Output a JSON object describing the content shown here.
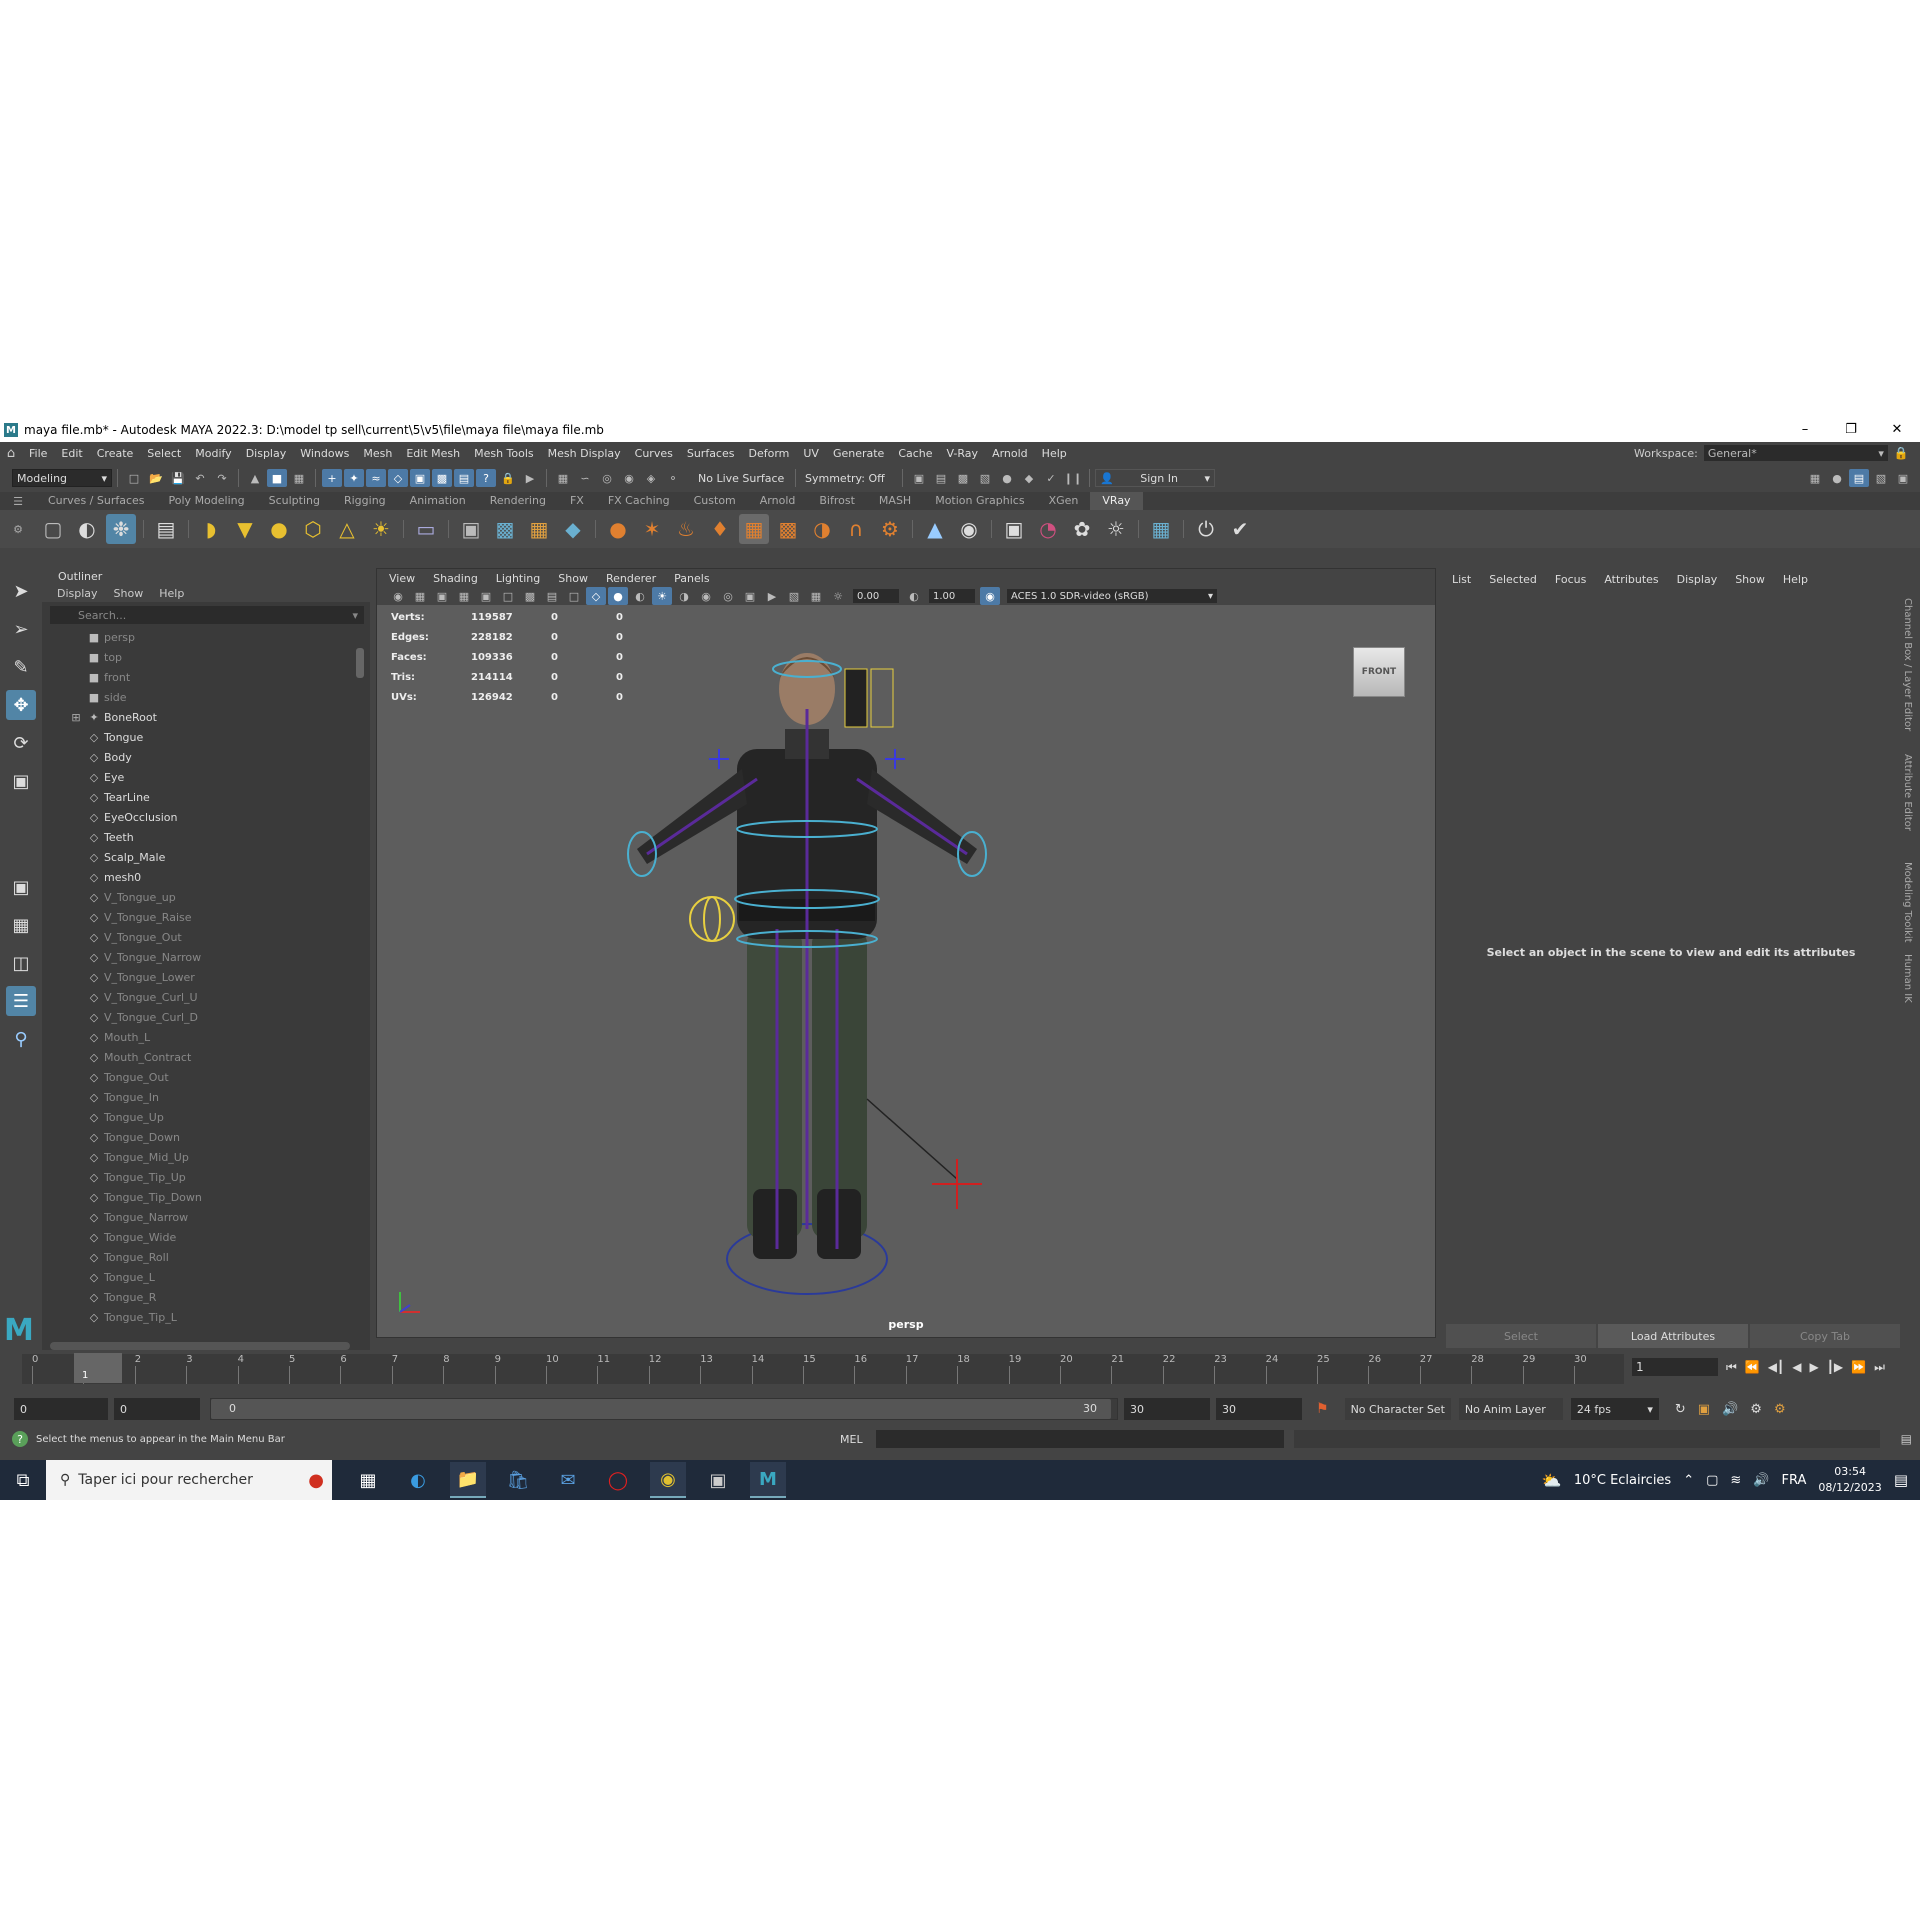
{
  "window": {
    "title": "maya file.mb* - Autodesk MAYA 2022.3: D:\\model tp sell\\current\\5\\v5\\file\\maya file\\maya file.mb",
    "logo": "M"
  },
  "menubar": {
    "items": [
      "File",
      "Edit",
      "Create",
      "Select",
      "Modify",
      "Display",
      "Windows",
      "Mesh",
      "Edit Mesh",
      "Mesh Tools",
      "Mesh Display",
      "Curves",
      "Surfaces",
      "Deform",
      "UV",
      "Generate",
      "Cache",
      "V-Ray",
      "Arnold",
      "Help"
    ],
    "workspace_label": "Workspace:",
    "workspace_value": "General*"
  },
  "statusline": {
    "mode": "Modeling",
    "live_surface": "No Live Surface",
    "symmetry": "Symmetry: Off",
    "sign_in": "Sign In"
  },
  "shelf_tabs": [
    "Curves / Surfaces",
    "Poly Modeling",
    "Sculpting",
    "Rigging",
    "Animation",
    "Rendering",
    "FX",
    "FX Caching",
    "Custom",
    "Arnold",
    "Bifrost",
    "MASH",
    "Motion Graphics",
    "XGen",
    "VRay"
  ],
  "outliner": {
    "title": "Outliner",
    "menu": [
      "Display",
      "Show",
      "Help"
    ],
    "search_placeholder": "Search...",
    "items": [
      {
        "label": "persp",
        "type": "camera",
        "dim": true
      },
      {
        "label": "top",
        "type": "camera",
        "dim": true
      },
      {
        "label": "front",
        "type": "camera",
        "dim": true
      },
      {
        "label": "side",
        "type": "camera",
        "dim": true
      },
      {
        "label": "BoneRoot",
        "type": "joint",
        "dim": false,
        "expandable": true
      },
      {
        "label": "Tongue",
        "type": "mesh",
        "dim": false
      },
      {
        "label": "Body",
        "type": "mesh",
        "dim": false
      },
      {
        "label": "Eye",
        "type": "mesh",
        "dim": false
      },
      {
        "label": "TearLine",
        "type": "mesh",
        "dim": false
      },
      {
        "label": "EyeOcclusion",
        "type": "mesh",
        "dim": false
      },
      {
        "label": "Teeth",
        "type": "mesh",
        "dim": false
      },
      {
        "label": "Scalp_Male",
        "type": "mesh",
        "dim": false
      },
      {
        "label": "mesh0",
        "type": "mesh",
        "dim": false
      },
      {
        "label": "V_Tongue_up",
        "type": "mesh",
        "dim": true
      },
      {
        "label": "V_Tongue_Raise",
        "type": "mesh",
        "dim": true
      },
      {
        "label": "V_Tongue_Out",
        "type": "mesh",
        "dim": true
      },
      {
        "label": "V_Tongue_Narrow",
        "type": "mesh",
        "dim": true
      },
      {
        "label": "V_Tongue_Lower",
        "type": "mesh",
        "dim": true
      },
      {
        "label": "V_Tongue_Curl_U",
        "type": "mesh",
        "dim": true
      },
      {
        "label": "V_Tongue_Curl_D",
        "type": "mesh",
        "dim": true
      },
      {
        "label": "Mouth_L",
        "type": "mesh",
        "dim": true
      },
      {
        "label": "Mouth_Contract",
        "type": "mesh",
        "dim": true
      },
      {
        "label": "Tongue_Out",
        "type": "mesh",
        "dim": true
      },
      {
        "label": "Tongue_In",
        "type": "mesh",
        "dim": true
      },
      {
        "label": "Tongue_Up",
        "type": "mesh",
        "dim": true
      },
      {
        "label": "Tongue_Down",
        "type": "mesh",
        "dim": true
      },
      {
        "label": "Tongue_Mid_Up",
        "type": "mesh",
        "dim": true
      },
      {
        "label": "Tongue_Tip_Up",
        "type": "mesh",
        "dim": true
      },
      {
        "label": "Tongue_Tip_Down",
        "type": "mesh",
        "dim": true
      },
      {
        "label": "Tongue_Narrow",
        "type": "mesh",
        "dim": true
      },
      {
        "label": "Tongue_Wide",
        "type": "mesh",
        "dim": true
      },
      {
        "label": "Tongue_Roll",
        "type": "mesh",
        "dim": true
      },
      {
        "label": "Tongue_L",
        "type": "mesh",
        "dim": true
      },
      {
        "label": "Tongue_R",
        "type": "mesh",
        "dim": true
      },
      {
        "label": "Tongue_Tip_L",
        "type": "mesh",
        "dim": true
      }
    ]
  },
  "viewport": {
    "menu": [
      "View",
      "Shading",
      "Lighting",
      "Show",
      "Renderer",
      "Panels"
    ],
    "exposure": "0.00",
    "gamma": "1.00",
    "colorspace": "ACES 1.0 SDR-video (sRGB)",
    "hud": [
      {
        "label": "Verts:",
        "v1": "119587",
        "v2": "0",
        "v3": "0"
      },
      {
        "label": "Edges:",
        "v1": "228182",
        "v2": "0",
        "v3": "0"
      },
      {
        "label": "Faces:",
        "v1": "109336",
        "v2": "0",
        "v3": "0"
      },
      {
        "label": "Tris:",
        "v1": "214114",
        "v2": "0",
        "v3": "0"
      },
      {
        "label": "UVs:",
        "v1": "126942",
        "v2": "0",
        "v3": "0"
      }
    ],
    "viewcube": "FRONT",
    "camera": "persp"
  },
  "attribute_editor": {
    "menu": [
      "List",
      "Selected",
      "Focus",
      "Attributes",
      "Display",
      "Show",
      "Help"
    ],
    "message": "Select an object in the scene to view and edit its attributes",
    "buttons": [
      "Select",
      "Load Attributes",
      "Copy Tab"
    ]
  },
  "side_tabs": [
    "Channel Box / Layer Editor",
    "Attribute Editor",
    "Modeling Toolkit",
    "Human IK"
  ],
  "timeline": {
    "ticks": [
      "0",
      "1",
      "2",
      "3",
      "4",
      "5",
      "6",
      "7",
      "8",
      "9",
      "10",
      "11",
      "12",
      "13",
      "14",
      "15",
      "16",
      "17",
      "18",
      "19",
      "20",
      "21",
      "22",
      "23",
      "24",
      "25",
      "26",
      "27",
      "28",
      "29",
      "30"
    ],
    "current_frame": "1",
    "frame_field": "1"
  },
  "range": {
    "start": "0",
    "anim_start": "0",
    "slider_start": "0",
    "slider_end": "30",
    "anim_end": "30",
    "end": "30",
    "character_set": "No Character Set",
    "anim_layer": "No Anim Layer",
    "fps": "24 fps"
  },
  "helpline": {
    "text": "Select the menus to appear in the Main Menu Bar",
    "lang": "MEL"
  },
  "taskbar": {
    "search_text": "Taper ici pour rechercher",
    "weather": "10°C Eclaircies",
    "lang": "FRA",
    "time": "03:54",
    "date": "08/12/2023"
  }
}
